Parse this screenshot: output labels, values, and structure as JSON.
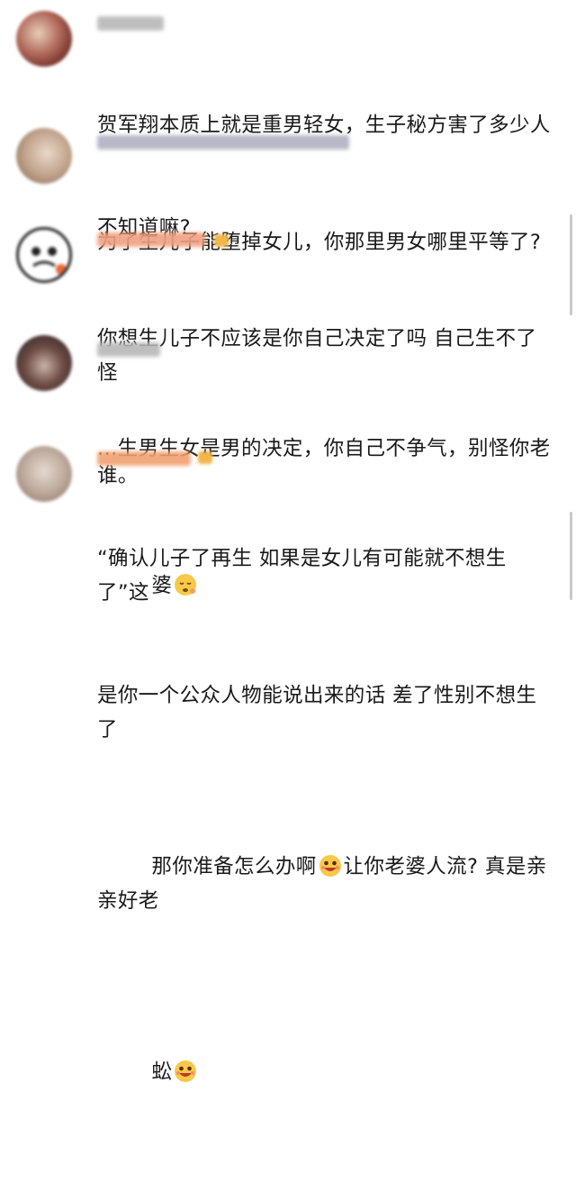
{
  "comments": [
    {
      "text_lines": [
        "贺军翔本质上就是重男轻女，生子秘方害了多少人",
        "不知道嘛?"
      ],
      "username_color": "#b8b8b8",
      "avatar_colors": [
        "#6b2b22",
        "#e8cdb6"
      ]
    },
    {
      "text_lines": [
        "为了生儿子能堕掉女儿，你那里男女哪里平等了?"
      ],
      "username_color": "#b0b0c0",
      "avatar_colors": [
        "#c2a48c",
        "#e9d8c9"
      ]
    },
    {
      "text_lines": [
        "你想生儿子不应该是你自己决定了吗 自己生不了怪",
        "谁。"
      ],
      "username_color": "#f0a080",
      "avatar_colors": [
        "#ffffff",
        "#222222"
      ]
    },
    {
      "text_lines": [
        "...生男生女是男的决定，你自己不争气，别怪你老",
        "婆"
      ],
      "username_color": "#b8b8b8",
      "avatar_colors": [
        "#3a2a2a",
        "#c9b3a8"
      ],
      "emoji": "pensive-face-emoji"
    },
    {
      "text_lines": [
        "“确认儿子了再生 如果是女儿有可能就不想生了”这",
        "是你一个公众人物能说出来的话 差了性别不想生了",
        "那你准备怎么办啊",
        "让你老婆人流? 真是亲亲好老",
        "蚣"
      ],
      "username_color": "#f0a070",
      "avatar_colors": [
        "#e6d9cf",
        "#8c7766"
      ],
      "emoji": "grinning-face-emoji"
    }
  ],
  "colors": {
    "text": "#1a1a1a",
    "crown": "#f2b64b",
    "scrollbar": "#c9c9c9"
  }
}
